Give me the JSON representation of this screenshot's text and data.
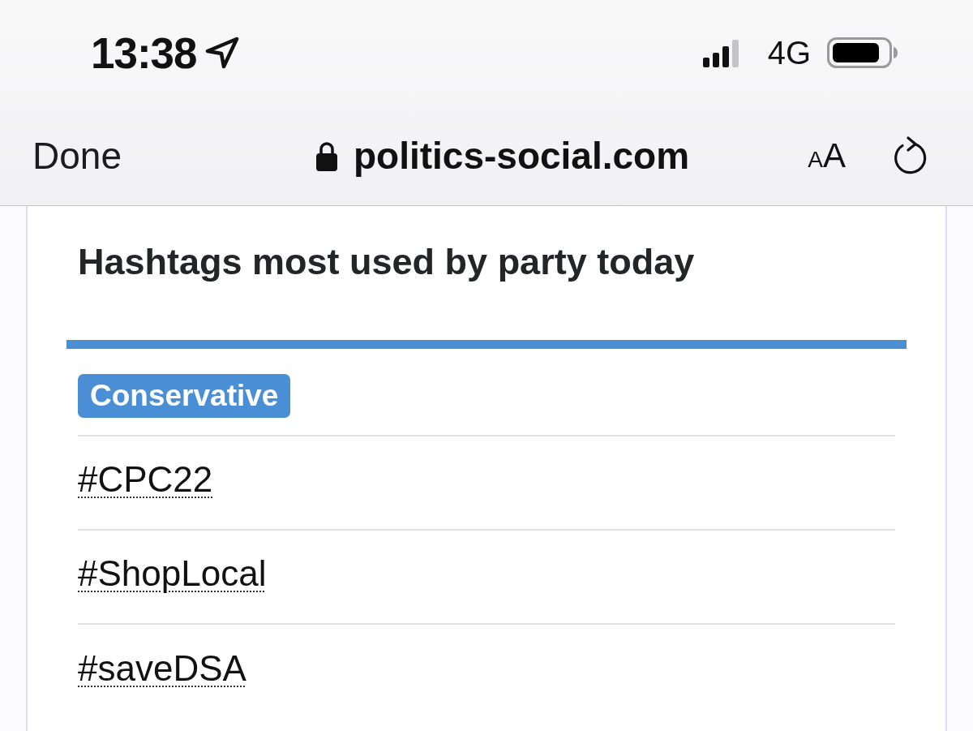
{
  "status_bar": {
    "time": "13:38",
    "network": "4G"
  },
  "browser_bar": {
    "done": "Done",
    "url": "politics-social.com",
    "text_size": "AA"
  },
  "card": {
    "title": "Hashtags most used by party today",
    "party_sections": [
      {
        "party": "Conservative",
        "hashtags": [
          "#CPC22",
          "#ShopLocal",
          "#saveDSA"
        ]
      }
    ]
  }
}
